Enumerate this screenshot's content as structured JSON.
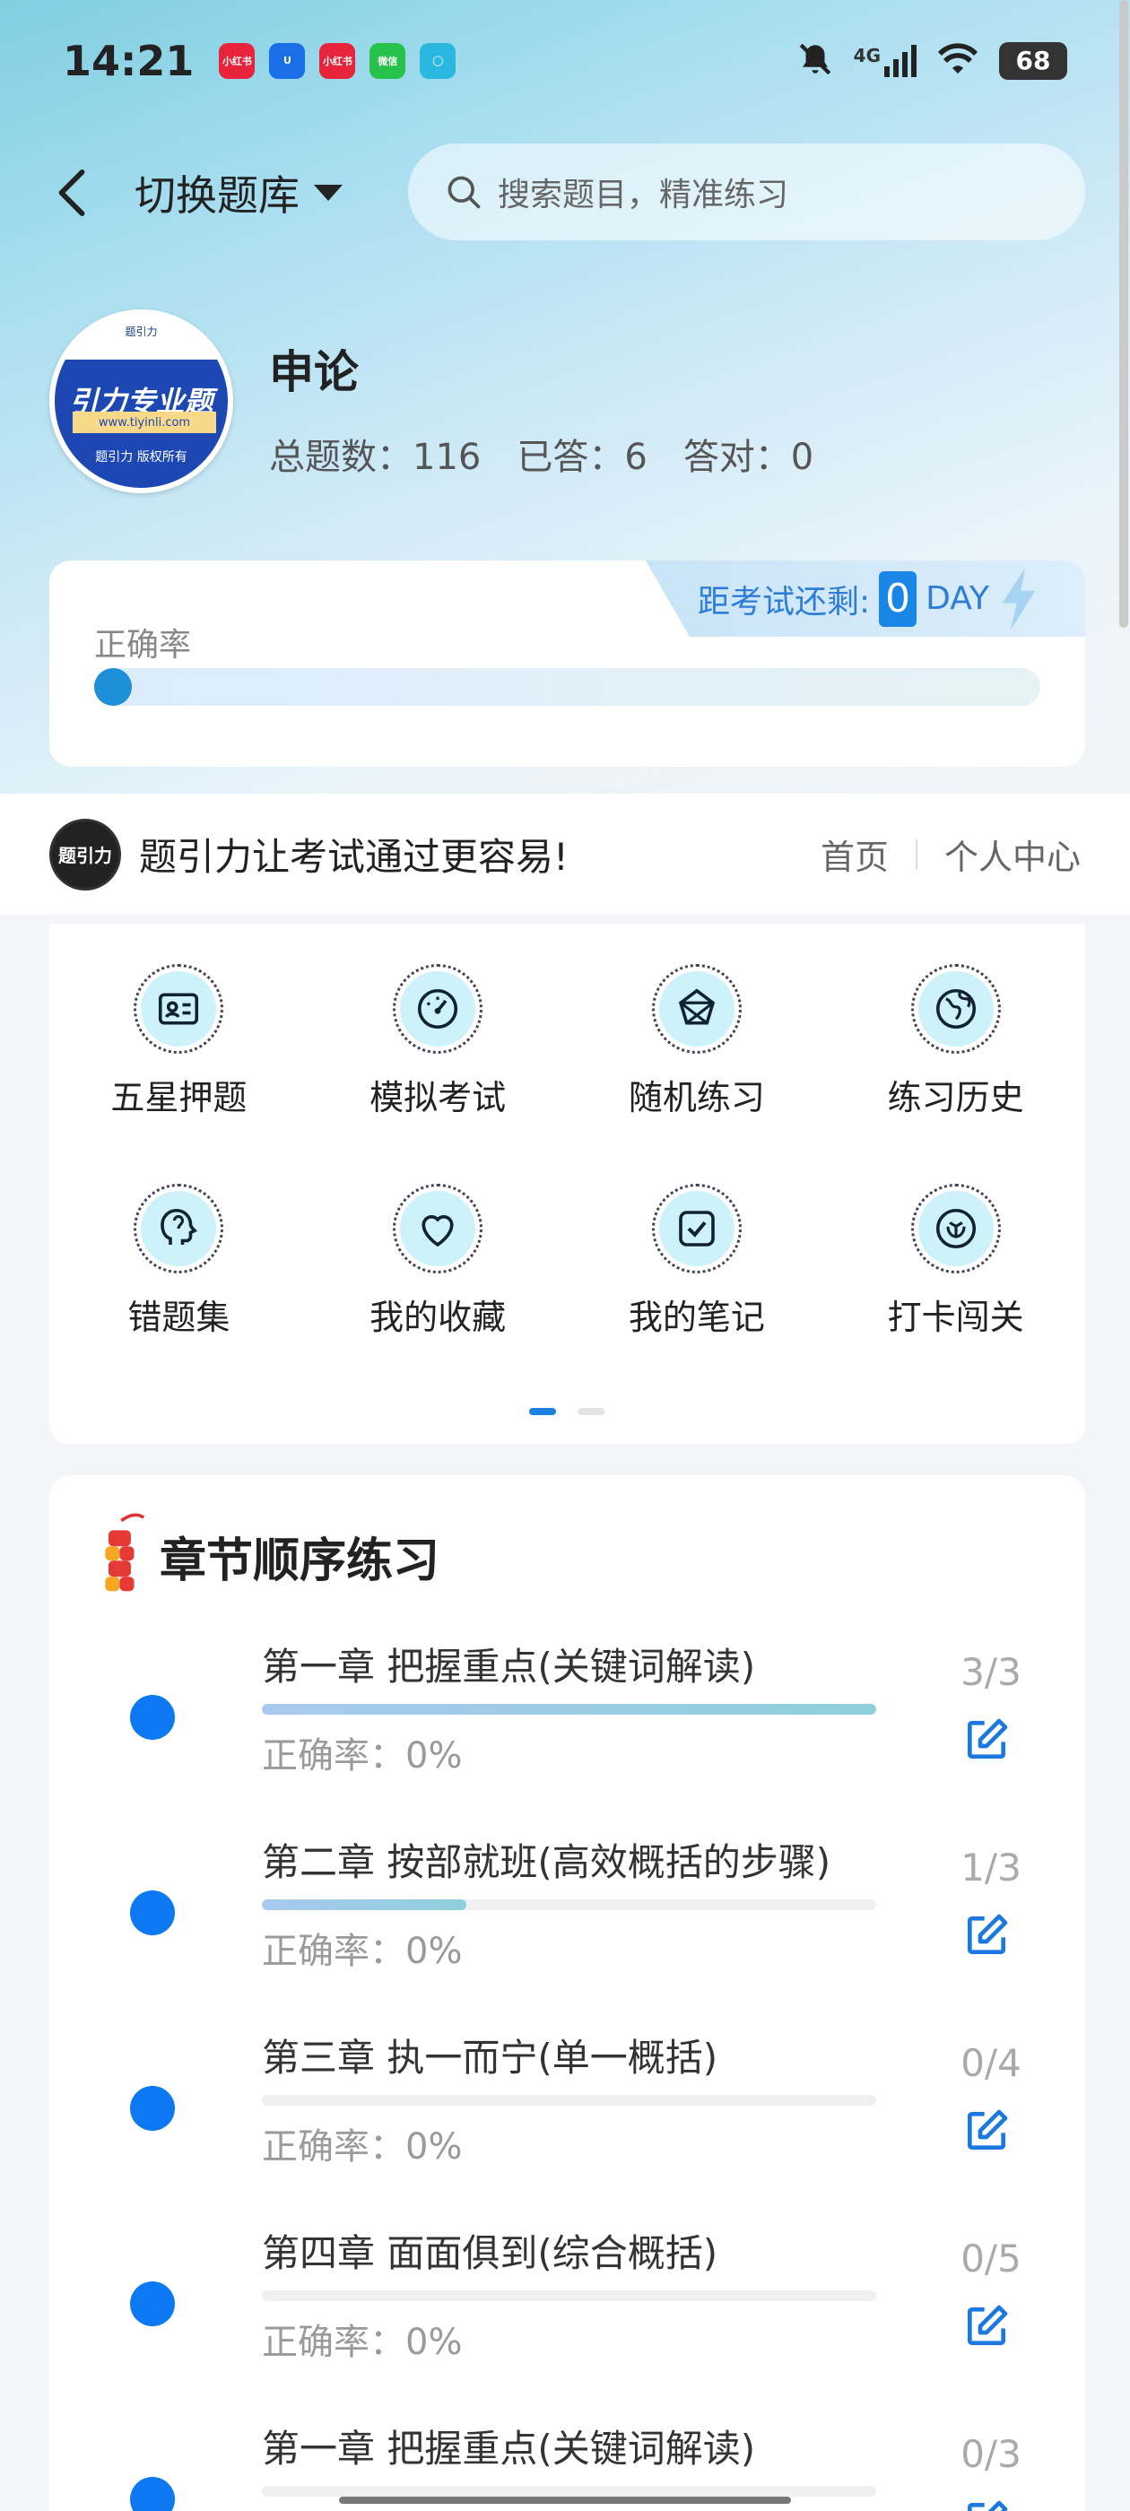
{
  "status_bar": {
    "time": "14:21",
    "notifications": [
      {
        "label": "小红书",
        "color": "#e8243c"
      },
      {
        "label": "U",
        "color": "#1b6fe6"
      },
      {
        "label": "小红书",
        "color": "#e8243c"
      },
      {
        "label": "微信",
        "color": "#27c24c"
      },
      {
        "label": "◯",
        "color": "#2bb8e0"
      }
    ],
    "network": "4G",
    "battery": "68"
  },
  "topbar": {
    "switch_label": "切换题库",
    "search_placeholder": "搜索题目，精准练习"
  },
  "profile": {
    "logo_top": "题引力",
    "logo_main": "引力专业题",
    "logo_url": "www.tiyinli.com",
    "logo_bottom": "题引力 版权所有",
    "subject": "申论",
    "total_label": "总题数：116",
    "answered_label": "已答：6",
    "correct_label": "答对：0"
  },
  "accuracy_card": {
    "exam_prefix": "距考试还剩:",
    "days": "0",
    "day_unit": "DAY",
    "label": "正确率",
    "accuracy_value": 0
  },
  "slogan_bar": {
    "logo_text": "题引力",
    "slogan": "题引力让考试通过更容易!",
    "home": "首页",
    "personal": "个人中心"
  },
  "menu": {
    "items": [
      {
        "label": "五星押题",
        "icon": "id-card-icon"
      },
      {
        "label": "模拟考试",
        "icon": "speedometer-icon"
      },
      {
        "label": "随机练习",
        "icon": "shuffle-icon"
      },
      {
        "label": "练习历史",
        "icon": "globe-icon"
      },
      {
        "label": "错题集",
        "icon": "head-icon"
      },
      {
        "label": "我的收藏",
        "icon": "heart-icon"
      },
      {
        "label": "我的笔记",
        "icon": "note-check-icon"
      },
      {
        "label": "打卡闯关",
        "icon": "badge-icon"
      }
    ],
    "page_index": 1,
    "page_count": 2
  },
  "chapters": {
    "title": "章节顺序练习",
    "items": [
      {
        "name": "第一章 把握重点(关键词解读)",
        "accuracy": "正确率：0%",
        "count": "3/3",
        "progress": 1.0
      },
      {
        "name": "第二章 按部就班(高效概括的步骤)",
        "accuracy": "正确率：0%",
        "count": "1/3",
        "progress": 0.333
      },
      {
        "name": "第三章 执一而宁(单一概括)",
        "accuracy": "正确率：0%",
        "count": "0/4",
        "progress": 0.0
      },
      {
        "name": "第四章 面面俱到(综合概括)",
        "accuracy": "正确率：0%",
        "count": "0/5",
        "progress": 0.0
      },
      {
        "name": "第一章 把握重点(关键词解读)",
        "accuracy": "",
        "count": "0/3",
        "progress": 0.0
      }
    ]
  }
}
